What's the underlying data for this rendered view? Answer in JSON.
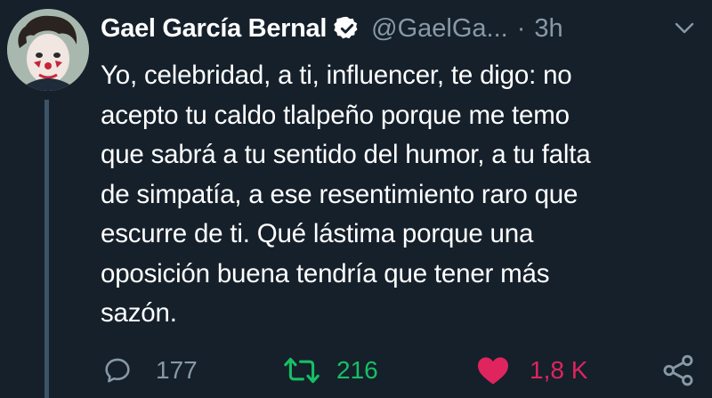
{
  "tweet": {
    "display_name": "Gael García Bernal",
    "handle": "@GaelGa...",
    "separator": "·",
    "time": "3h",
    "text": "Yo, celebridad, a ti, influencer, te digo: no\nacepto tu caldo tlalpeño porque me temo\nque sabrá a tu sentido del humor, a tu falta\nde simpatía, a ese resentimiento raro que\nescurre de ti. Qué lástima porque una\noposición buena tendría que tener más\nsazón.",
    "actions": {
      "replies": "177",
      "retweets": "216",
      "likes": "1,8 K"
    }
  },
  "icons": {
    "avatar": "avatar-clown-face",
    "verified": "verified-badge-icon",
    "chevron": "chevron-down-icon",
    "reply": "reply-icon",
    "retweet": "retweet-icon",
    "like": "heart-icon",
    "share": "share-icon"
  },
  "colors": {
    "background": "#15202b",
    "secondary_text": "#8899a6",
    "retweet_active": "#17bf63",
    "like_active": "#e0245e",
    "thread_line": "#3d5466"
  }
}
